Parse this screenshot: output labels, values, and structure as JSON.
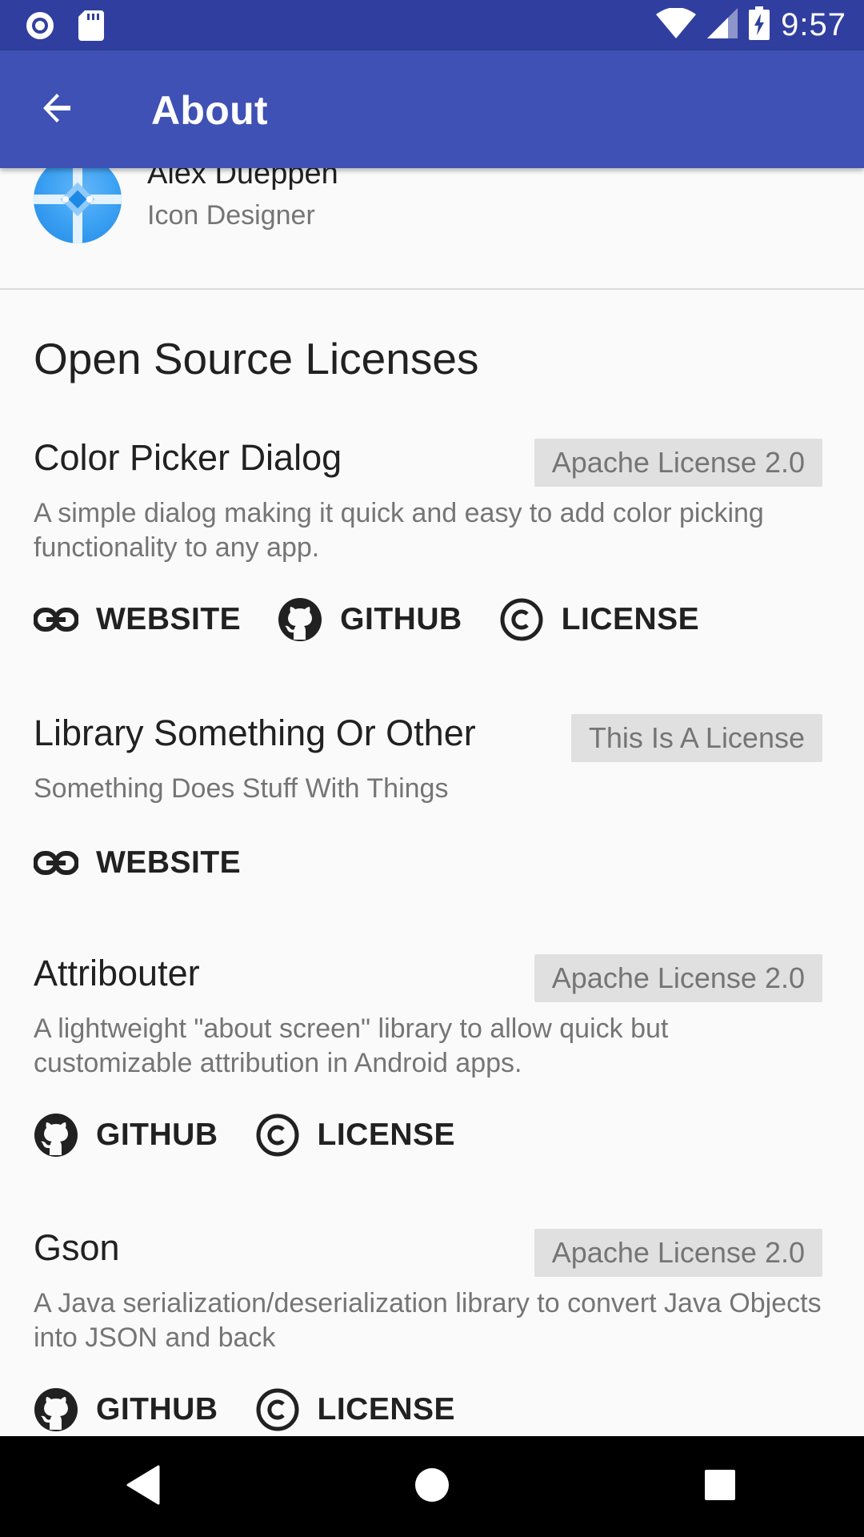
{
  "status_bar": {
    "time": "9:57",
    "icons": [
      "notification-dot-icon",
      "sd-card-icon",
      "wifi-icon",
      "cell-signal-icon",
      "battery-charging-icon"
    ]
  },
  "app_bar": {
    "title": "About",
    "back_icon": "arrow-back-icon"
  },
  "contributor": {
    "name": "Alex Dueppen",
    "role": "Icon Designer"
  },
  "section_title": "Open Source Licenses",
  "libraries": [
    {
      "name": "Color Picker Dialog",
      "license": "Apache License 2.0",
      "description": "A simple dialog making it quick and easy to add color picking functionality to any app.",
      "actions": [
        "WEBSITE",
        "GITHUB",
        "LICENSE"
      ]
    },
    {
      "name": "Library Something Or Other",
      "license": "This Is A License",
      "description": "Something Does Stuff With Things",
      "actions": [
        "WEBSITE"
      ]
    },
    {
      "name": "Attribouter",
      "license": "Apache License 2.0",
      "description": "A lightweight \"about screen\" library to allow quick but customizable attribution in Android apps.",
      "actions": [
        "GITHUB",
        "LICENSE"
      ]
    },
    {
      "name": "Gson",
      "license": "Apache License 2.0",
      "description": "A Java serialization/deserialization library to convert Java Objects into JSON and back",
      "actions": [
        "GITHUB",
        "LICENSE"
      ]
    }
  ],
  "nav_bar": {
    "buttons": [
      "back-triangle-icon",
      "home-circle-icon",
      "recents-square-icon"
    ]
  },
  "colors": {
    "status_bar": "#303f9f",
    "app_bar": "#3f51b5",
    "background": "#fafafa",
    "badge_bg": "#e0e0e0",
    "text_primary": "#212121",
    "text_secondary": "#757575"
  }
}
